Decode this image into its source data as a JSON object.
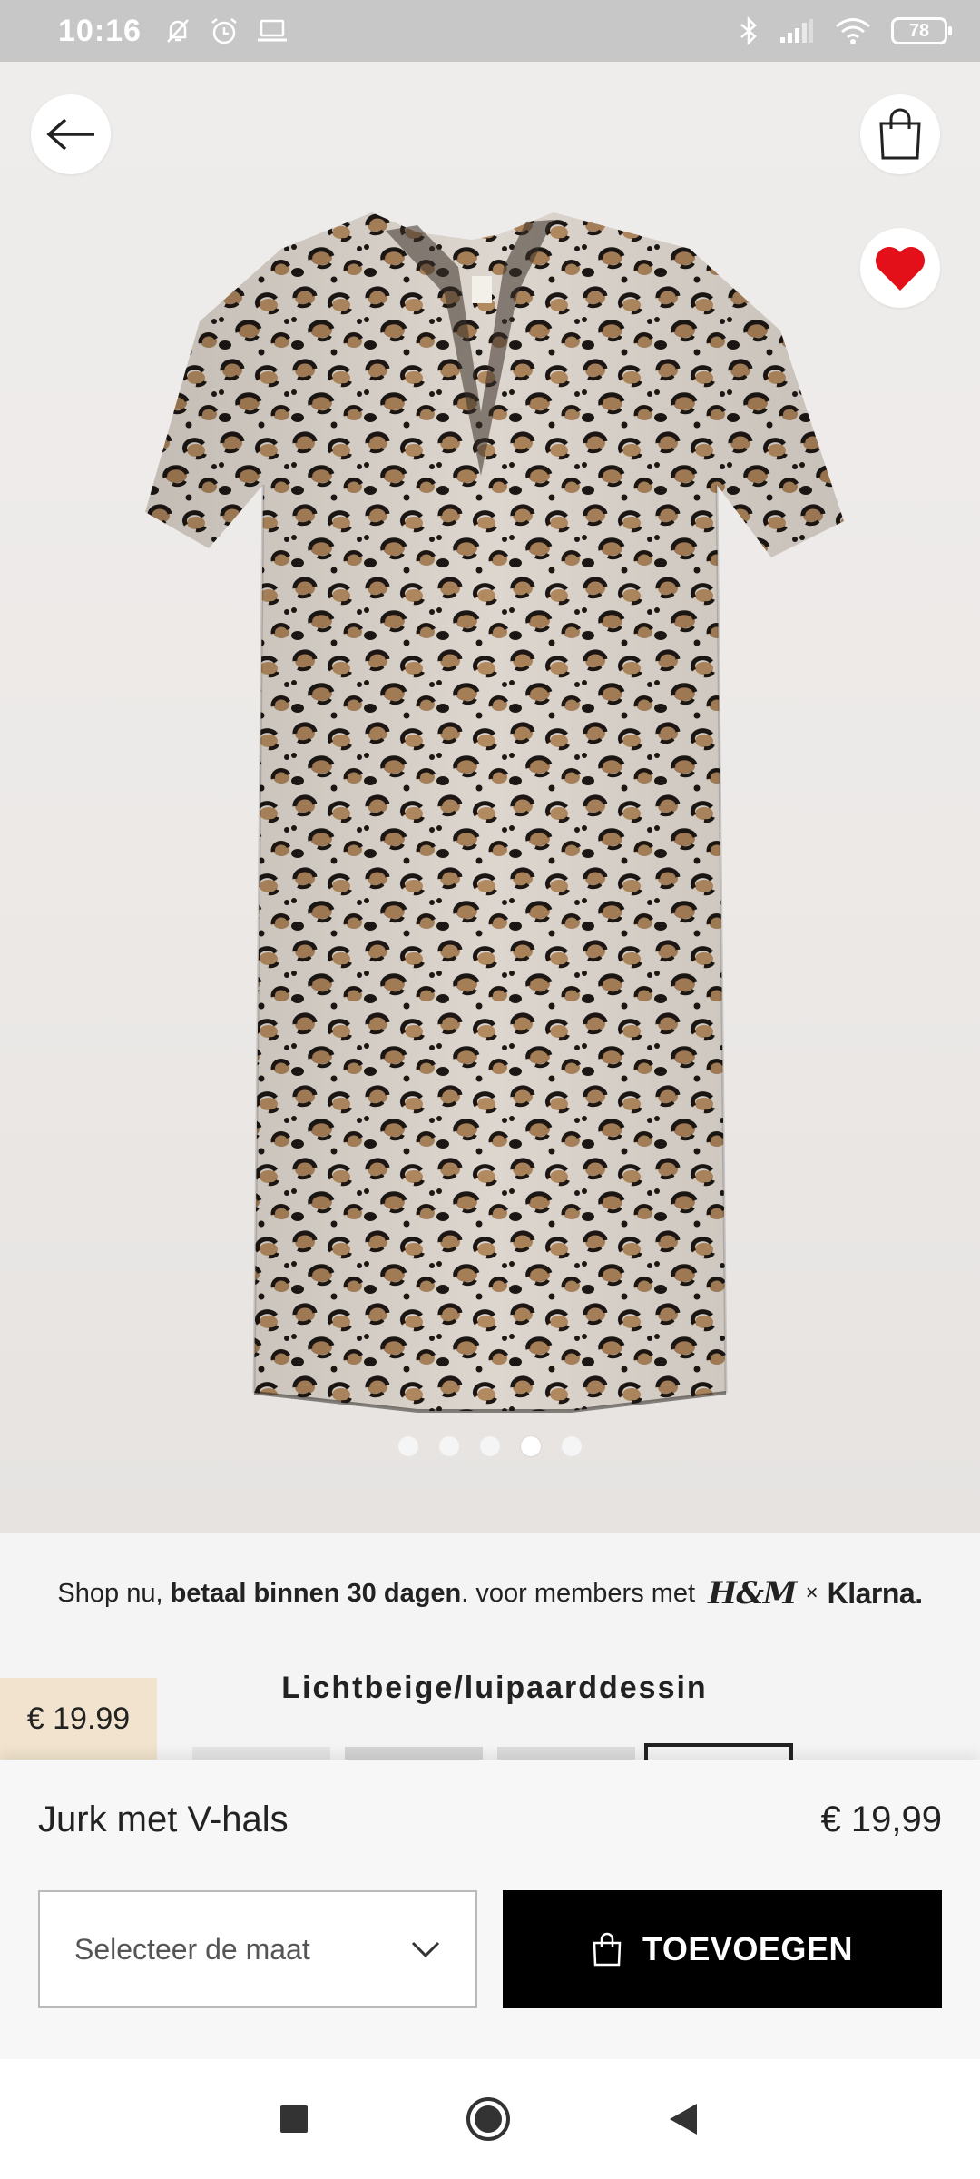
{
  "status_bar": {
    "time": "10:16",
    "battery": "78",
    "left_icons": [
      "bell-off-icon",
      "alarm-icon",
      "laptop-icon"
    ],
    "right_icons": [
      "bluetooth-icon",
      "signal-icon",
      "wifi-icon",
      "battery-icon"
    ]
  },
  "header": {
    "back_icon": "arrow-left-icon",
    "bag_icon": "shopping-bag-icon",
    "favorite_icon": "heart-icon",
    "favorite_color": "#e3101a"
  },
  "gallery": {
    "image_count": 5,
    "active_index": 3
  },
  "promo": {
    "prefix": "Shop nu,",
    "bold": "betaal binnen 30 dagen",
    "suffix": ". voor members met",
    "brand": "H&M",
    "separator": "×",
    "partner": "Klarna."
  },
  "product": {
    "price_tag": "€ 19.99",
    "color_name": "Lichtbeige/luipaarddessin",
    "name": "Jurk met V-hals",
    "price": "€ 19,99"
  },
  "actions": {
    "size_placeholder": "Selecteer de maat",
    "add_label": "TOEVOEGEN"
  },
  "navigation": {
    "icons": [
      "recent-apps-icon",
      "home-icon",
      "back-icon"
    ]
  },
  "colors": {
    "price_tag_bg": "#f1e3cd",
    "add_button_bg": "#000000"
  }
}
